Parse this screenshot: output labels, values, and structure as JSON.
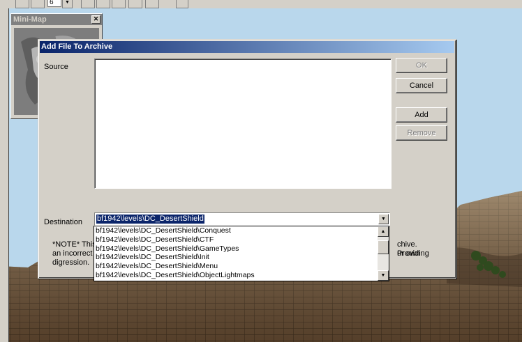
{
  "minimap": {
    "title": "Mini-Map",
    "close_glyph": "✕"
  },
  "toolbar": {
    "number_value": "6"
  },
  "dialog": {
    "title": "Add File To Archive",
    "source_label": "Source",
    "destination_label": "Destination",
    "buttons": {
      "ok": "OK",
      "cancel": "Cancel",
      "add": "Add",
      "remove": "Remove"
    },
    "destination_value": "bf1942\\levels\\DC_DesertShield",
    "note_line1_left": "*NOTE* This",
    "note_line1_right": "chive.  Providing",
    "note_line2_left": "an incorrect",
    "note_line2_right": "ur own",
    "note_line3_left": "digression."
  },
  "dropdown": {
    "items": [
      "bf1942\\levels\\DC_DesertShield\\Conquest",
      "bf1942\\levels\\DC_DesertShield\\CTF",
      "bf1942\\levels\\DC_DesertShield\\GameTypes",
      "bf1942\\levels\\DC_DesertShield\\Init",
      "bf1942\\levels\\DC_DesertShield\\Menu",
      "bf1942\\levels\\DC_DesertShield\\ObjectLightmaps"
    ]
  },
  "colors": {
    "sky": "#b9d7ec",
    "terrain": "#6b5036",
    "titlebar_start": "#0a246a",
    "titlebar_end": "#a6caf0",
    "selection": "#0a246a"
  }
}
